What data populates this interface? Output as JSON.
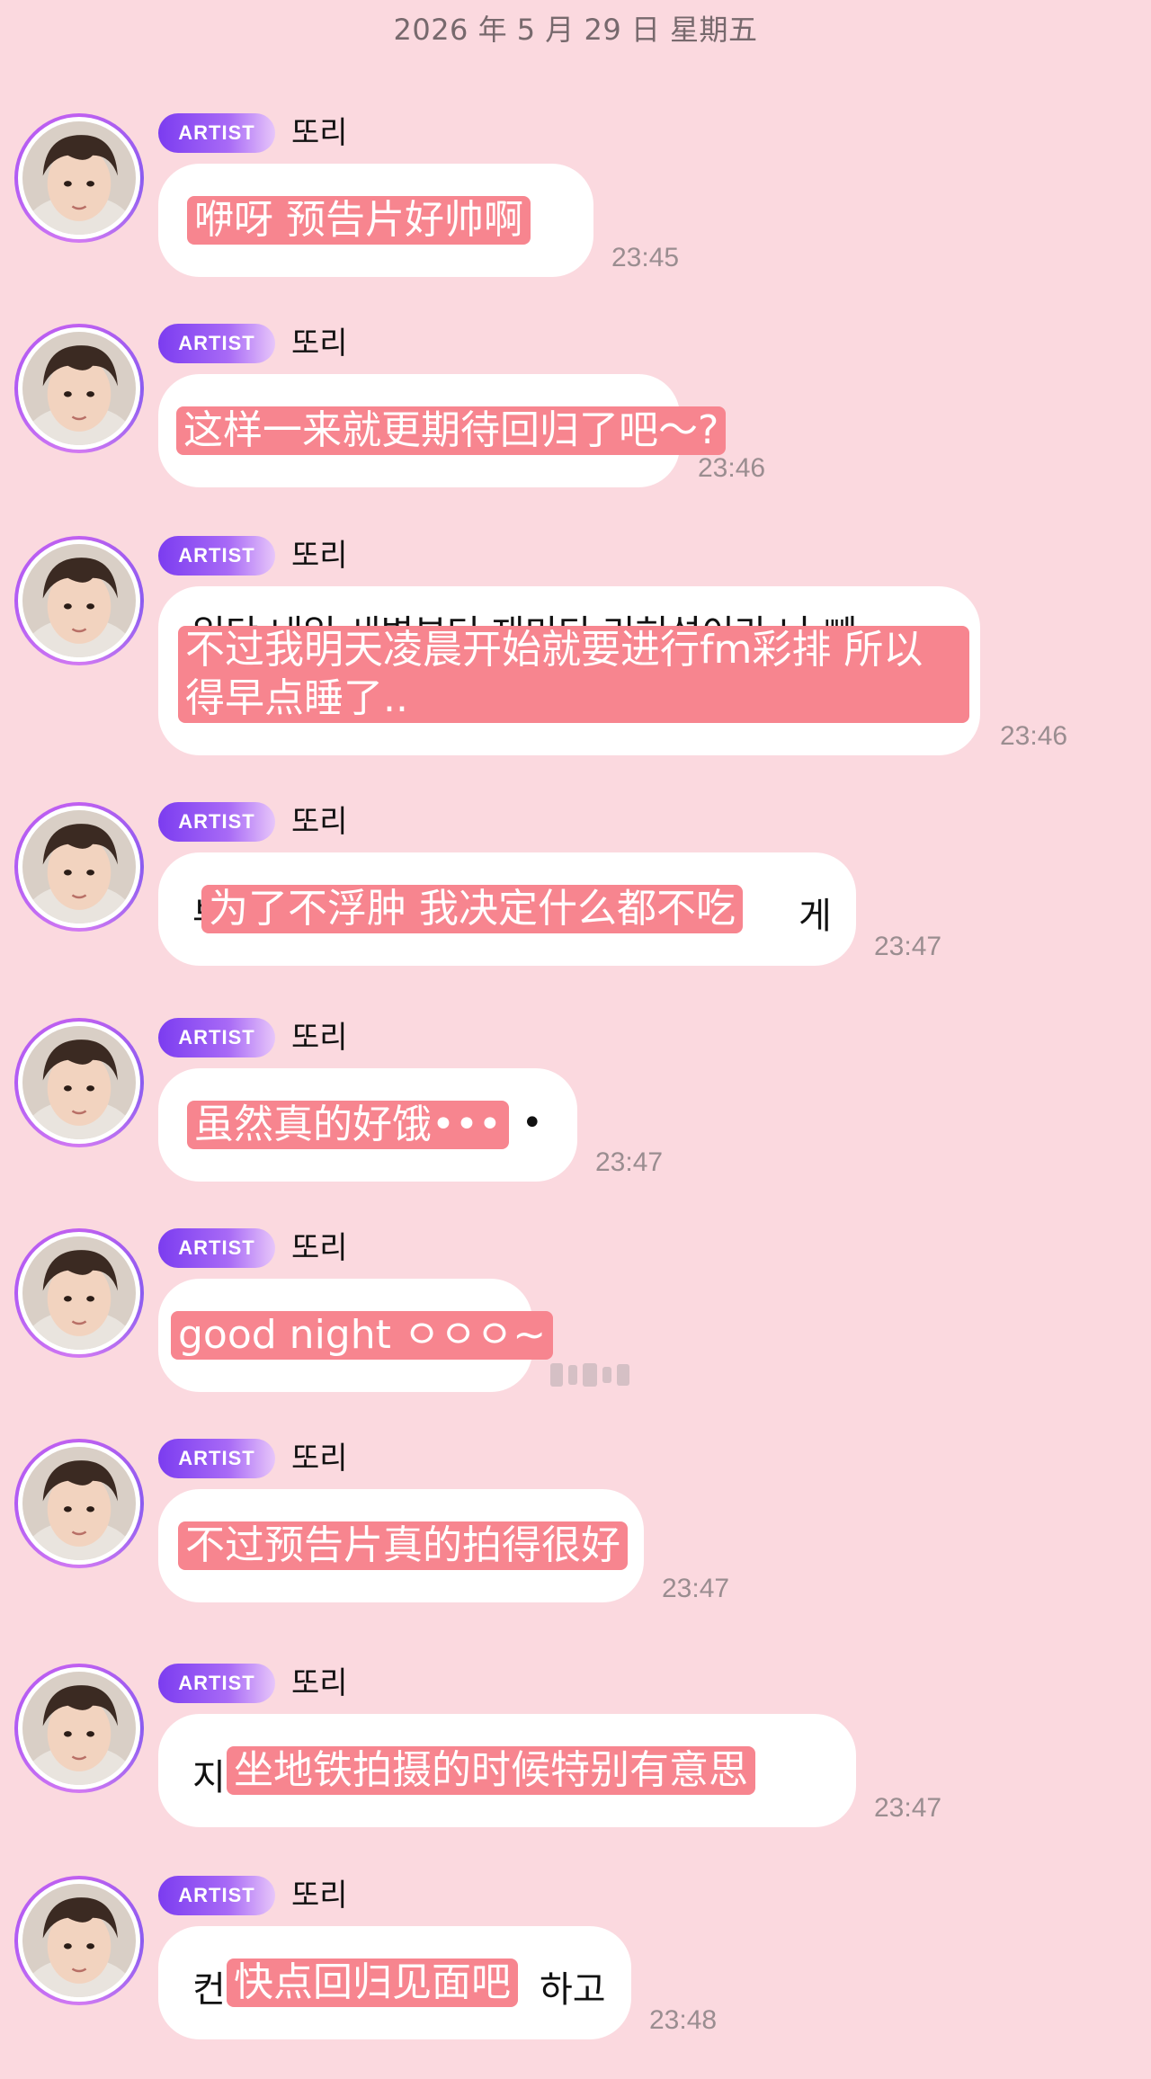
{
  "date_header": "2026 年 5 月 29 日 星期五",
  "artist_badge": "ARTIST",
  "messages": [
    {
      "name": "또리",
      "ghost": "",
      "text": "咿呀 预告片好帅啊",
      "time": "23:45"
    },
    {
      "name": "또리",
      "ghost": "",
      "text": "这样一来就更期待回归了吧～?",
      "time": "23:46"
    },
    {
      "name": "또리",
      "ghost": "일단 내일 새벽부터 재미티 리허설이라 나 빼",
      "text": "不过我明天凌晨开始就要进行fm彩排 所以得早点睡了..",
      "time": "23:46"
    },
    {
      "name": "또리",
      "ghost_left": "부",
      "ghost_right": "게",
      "text": "为了不浮肿 我决定什么都不吃",
      "time": "23:47"
    },
    {
      "name": "또리",
      "ghost_right": "•",
      "text": "虽然真的好饿•••",
      "time": "23:47"
    },
    {
      "name": "또리",
      "ghost": "",
      "text": "good night ㅇㅇㅇ~",
      "time": ""
    },
    {
      "name": "또리",
      "ghost": "",
      "text": "不过预告片真的拍得很好",
      "time": "23:47"
    },
    {
      "name": "또리",
      "ghost_left": "지",
      "text": "坐地铁拍摄的时候特别有意思",
      "time": "23:47"
    },
    {
      "name": "또리",
      "ghost_left": "컨",
      "ghost_right": "하고",
      "text": "快点回归见面吧",
      "time": "23:48"
    }
  ]
}
